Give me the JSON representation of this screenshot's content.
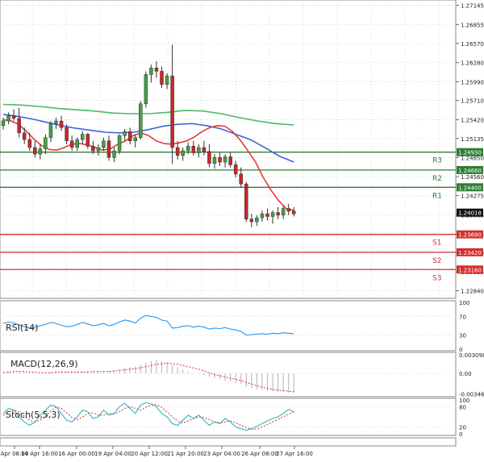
{
  "colors": {
    "bull": "#43a047",
    "bear": "#c62828",
    "ma_fast": "#e53935",
    "ma_mid": "#3f66d8",
    "ma_slow": "#49b86a",
    "rsi_line": "#2196f3",
    "resistance": "#2e7d32",
    "support": "#d32f2f",
    "stoch_main": "#2ab7c4",
    "stoch_signal": "#d32f2f",
    "macd_bar": "#bdbdbd",
    "macd_signal": "#d32f2f",
    "grid": "#d7d7d7"
  },
  "price_axis": {
    "ticks": [
      "1.27145",
      "1.26855",
      "1.26570",
      "1.26280",
      "1.25990",
      "1.25710",
      "1.25420",
      "1.25135",
      "1.24850",
      "1.24560",
      "1.24275",
      "1.23985",
      "1.23695",
      "1.23410",
      "1.23125",
      "1.22840"
    ],
    "current_price": "1.24018"
  },
  "levels": [
    {
      "label": "R3",
      "value": "1.24930",
      "type": "resistance"
    },
    {
      "label": "R2",
      "value": "1.24660",
      "type": "resistance"
    },
    {
      "label": "R1",
      "value": "1.24400",
      "type": "resistance"
    },
    {
      "label": "S1",
      "value": "1.23690",
      "type": "support"
    },
    {
      "label": "S2",
      "value": "1.23420",
      "type": "support"
    },
    {
      "label": "S3",
      "value": "1.23160",
      "type": "support"
    }
  ],
  "panels": {
    "rsi": {
      "label": "RSI(14)",
      "ticks": [
        "100",
        "70",
        "30",
        "0"
      ]
    },
    "macd": {
      "label": "MACD(12,26,9)",
      "ticks": [
        "0.003098",
        "0.00",
        "-0.003465"
      ]
    },
    "stoch": {
      "label": "Stoch(5,5,3)",
      "ticks": [
        "100",
        "80",
        "20",
        "0"
      ]
    }
  },
  "time_axis": [
    "Apr 08:00",
    "14 Apr 16:00",
    "16 Apr 00:00",
    "19 Apr 04:00",
    "20 Apr 12:00",
    "21 Apr 20:00",
    "23 Apr 04:00",
    "26 Apr 08:00",
    "27 Apr 16:00"
  ],
  "chart_data": {
    "type": "candlestick",
    "candles": [
      [
        1.2533,
        1.2545,
        1.2527,
        1.254
      ],
      [
        1.254,
        1.2553,
        1.2535,
        1.2548
      ],
      [
        1.2548,
        1.2558,
        1.254,
        1.2544
      ],
      [
        1.2544,
        1.256,
        1.2515,
        1.2522
      ],
      [
        1.2522,
        1.253,
        1.2505,
        1.2512
      ],
      [
        1.2512,
        1.2522,
        1.2495,
        1.25
      ],
      [
        1.25,
        1.251,
        1.2485,
        1.249
      ],
      [
        1.249,
        1.2505,
        1.2482,
        1.2498
      ],
      [
        1.2498,
        1.252,
        1.249,
        1.2515
      ],
      [
        1.2515,
        1.254,
        1.2508,
        1.2536
      ],
      [
        1.2536,
        1.2545,
        1.2528,
        1.254
      ],
      [
        1.254,
        1.2548,
        1.2525,
        1.253
      ],
      [
        1.253,
        1.2535,
        1.2505,
        1.251
      ],
      [
        1.251,
        1.2518,
        1.2495,
        1.25
      ],
      [
        1.25,
        1.2515,
        1.2495,
        1.2512
      ],
      [
        1.2512,
        1.2525,
        1.2505,
        1.252
      ],
      [
        1.252,
        1.2522,
        1.2498,
        1.2502
      ],
      [
        1.2502,
        1.251,
        1.249,
        1.2495
      ],
      [
        1.2495,
        1.2505,
        1.2488,
        1.25
      ],
      [
        1.25,
        1.2515,
        1.2495,
        1.251
      ],
      [
        1.251,
        1.2518,
        1.248,
        1.2485
      ],
      [
        1.2485,
        1.25,
        1.2478,
        1.2495
      ],
      [
        1.2495,
        1.252,
        1.249,
        1.2518
      ],
      [
        1.2518,
        1.2528,
        1.251,
        1.2524
      ],
      [
        1.2524,
        1.253,
        1.2505,
        1.251
      ],
      [
        1.251,
        1.252,
        1.25,
        1.2515
      ],
      [
        1.2515,
        1.257,
        1.2512,
        1.2566
      ],
      [
        1.2566,
        1.2615,
        1.256,
        1.261
      ],
      [
        1.261,
        1.2625,
        1.2598,
        1.262
      ],
      [
        1.262,
        1.263,
        1.2605,
        1.2615
      ],
      [
        1.2615,
        1.2622,
        1.259,
        1.2595
      ],
      [
        1.2595,
        1.2612,
        1.2588,
        1.2608
      ],
      [
        1.2608,
        1.2655,
        1.2475,
        1.25
      ],
      [
        1.25,
        1.251,
        1.2482,
        1.2488
      ],
      [
        1.2488,
        1.25,
        1.248,
        1.2495
      ],
      [
        1.2495,
        1.2508,
        1.249,
        1.2502
      ],
      [
        1.2502,
        1.251,
        1.2488,
        1.2492
      ],
      [
        1.2492,
        1.2505,
        1.2485,
        1.25
      ],
      [
        1.25,
        1.251,
        1.2488,
        1.2494
      ],
      [
        1.2494,
        1.2505,
        1.247,
        1.2476
      ],
      [
        1.2476,
        1.249,
        1.2468,
        1.2485
      ],
      [
        1.2485,
        1.2492,
        1.2472,
        1.2478
      ],
      [
        1.2478,
        1.249,
        1.247,
        1.2486
      ],
      [
        1.2486,
        1.2492,
        1.247,
        1.2474
      ],
      [
        1.2474,
        1.248,
        1.2455,
        1.246
      ],
      [
        1.246,
        1.247,
        1.244,
        1.2445
      ],
      [
        1.2445,
        1.2448,
        1.2388,
        1.2392
      ],
      [
        1.2392,
        1.24,
        1.238,
        1.2388
      ],
      [
        1.2388,
        1.2398,
        1.2382,
        1.2394
      ],
      [
        1.2394,
        1.2405,
        1.2388,
        1.24
      ],
      [
        1.24,
        1.2408,
        1.239,
        1.2396
      ],
      [
        1.2396,
        1.2405,
        1.2385,
        1.2402
      ],
      [
        1.2402,
        1.241,
        1.2392,
        1.2398
      ],
      [
        1.2398,
        1.2412,
        1.2392,
        1.2408
      ],
      [
        1.2408,
        1.2415,
        1.2398,
        1.2404
      ],
      [
        1.2404,
        1.241,
        1.2396,
        1.24
      ]
    ],
    "ma_fast": [
      1.2542,
      1.254,
      1.2535,
      1.2525,
      1.2513,
      1.2503,
      1.2497,
      1.2496,
      1.25,
      1.2505,
      1.2506,
      1.2504,
      1.25,
      1.2496,
      1.2498,
      1.2505,
      1.251,
      1.2518,
      1.2522,
      1.2518,
      1.251,
      1.2506,
      1.2505,
      1.2507,
      1.251,
      1.2516,
      1.2524,
      1.253,
      1.2533,
      1.2532,
      1.2524,
      1.2511,
      1.2495,
      1.2478,
      1.2455,
      1.2436,
      1.242,
      1.2408,
      1.2405
    ],
    "ma_mid": [
      1.255,
      1.2547,
      1.2543,
      1.2538,
      1.2533,
      1.2529,
      1.2526,
      1.2523,
      1.2522,
      1.2523,
      1.2527,
      1.2532,
      1.2535,
      1.2536,
      1.2533,
      1.2528,
      1.252,
      1.2512,
      1.25,
      1.2487,
      1.2478
    ],
    "ma_slow": [
      1.2565,
      1.2564,
      1.2562,
      1.2559,
      1.2557,
      1.2555,
      1.2552,
      1.2551,
      1.2551,
      1.2553,
      1.2556,
      1.2555,
      1.2551,
      1.2545,
      1.254,
      1.2536,
      1.2534
    ],
    "rsi": [
      55,
      58,
      56,
      52,
      48,
      45,
      47,
      50,
      53,
      57,
      55,
      51,
      48,
      49,
      53,
      57,
      54,
      50,
      52,
      55,
      50,
      53,
      58,
      62,
      60,
      56,
      66,
      72,
      70,
      68,
      62,
      60,
      45,
      46,
      49,
      50,
      47,
      49,
      47,
      43,
      45,
      44,
      46,
      43,
      41,
      38,
      30,
      31,
      32,
      33,
      32,
      34,
      33,
      35,
      34,
      33
    ],
    "macd": [
      0.0002,
      0.0003,
      0.0004,
      0.0003,
      0.0002,
      0.0001,
      0.0,
      0.0,
      0.0001,
      0.0002,
      0.0003,
      0.0003,
      0.0002,
      0.0002,
      0.0002,
      0.0003,
      0.0003,
      0.0003,
      0.0003,
      0.0004,
      0.0004,
      0.0005,
      0.0007,
      0.0009,
      0.001,
      0.0011,
      0.0014,
      0.0018,
      0.0021,
      0.0022,
      0.0021,
      0.0018,
      0.0014,
      0.001,
      0.0006,
      0.0003,
      0.0001,
      -0.0001,
      -0.0003,
      -0.0006,
      -0.0008,
      -0.001,
      -0.0012,
      -0.0014,
      -0.0016,
      -0.0018,
      -0.0022,
      -0.0025,
      -0.0027,
      -0.0028,
      -0.0029,
      -0.003,
      -0.0031,
      -0.0031,
      -0.0032,
      -0.0032
    ],
    "macd_signal": [
      0.0001,
      0.0002,
      0.0003,
      0.0003,
      0.0003,
      0.0002,
      0.0002,
      0.0001,
      0.0001,
      0.0001,
      0.0002,
      0.0002,
      0.0002,
      0.0002,
      0.0002,
      0.0002,
      0.0002,
      0.0003,
      0.0003,
      0.0003,
      0.0003,
      0.0004,
      0.0005,
      0.0006,
      0.0007,
      0.0008,
      0.0009,
      0.0011,
      0.0013,
      0.0015,
      0.0016,
      0.0017,
      0.0016,
      0.0015,
      0.0013,
      0.0011,
      0.0009,
      0.0007,
      0.0004,
      0.0001,
      -0.0002,
      -0.0004,
      -0.0006,
      -0.0008,
      -0.001,
      -0.0012,
      -0.0015,
      -0.0018,
      -0.0021,
      -0.0023,
      -0.0025,
      -0.0027,
      -0.0028,
      -0.0029,
      -0.003,
      -0.0031
    ],
    "stoch_k": [
      60,
      75,
      70,
      50,
      35,
      25,
      35,
      55,
      70,
      85,
      80,
      60,
      40,
      35,
      50,
      70,
      65,
      45,
      50,
      70,
      55,
      60,
      80,
      90,
      75,
      60,
      85,
      92,
      88,
      80,
      60,
      50,
      30,
      25,
      40,
      55,
      45,
      55,
      40,
      25,
      35,
      30,
      45,
      35,
      20,
      15,
      10,
      15,
      22,
      30,
      38,
      45,
      50,
      60,
      72,
      65
    ],
    "stoch_d": [
      55,
      65,
      70,
      65,
      52,
      40,
      35,
      40,
      52,
      68,
      78,
      75,
      62,
      48,
      42,
      50,
      60,
      62,
      55,
      55,
      60,
      58,
      65,
      75,
      80,
      75,
      70,
      78,
      85,
      86,
      78,
      65,
      50,
      38,
      32,
      38,
      45,
      50,
      48,
      42,
      35,
      32,
      35,
      38,
      32,
      25,
      18,
      14,
      14,
      20,
      28,
      35,
      42,
      50,
      58,
      65
    ]
  }
}
